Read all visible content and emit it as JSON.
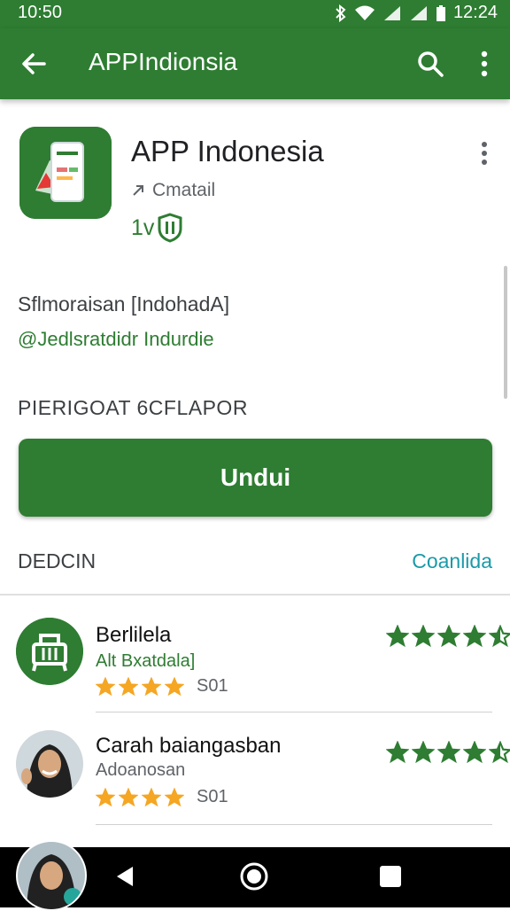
{
  "status_bar": {
    "time_left": "10:50",
    "time_right": "12:24"
  },
  "app_bar": {
    "title": "APPIndionsia"
  },
  "app": {
    "name": "APP Indonesia",
    "developer": "Cmatail",
    "rating": "1v",
    "icon_name": "phone-app-icon"
  },
  "details": {
    "line1": "Sflmoraisan [IndohadA]",
    "line2": "@Jedlsratdidr Indurdie"
  },
  "section_header": "PIERIGOAT 6CFLAPOR",
  "install_button": "Undui",
  "reviews_section": {
    "title": "DEDCIN",
    "link": "Coanlida"
  },
  "reviews": [
    {
      "name": "Berlilela",
      "subtitle": "Alt Bxatdala]",
      "count": "S01",
      "rating_small": 4,
      "rating_big": 4.5,
      "subtitle_color": "#2e7d32"
    },
    {
      "name": "Carah baiangasban",
      "subtitle": "Adoanosan",
      "count": "S01",
      "rating_small": 4,
      "rating_big": 4.5,
      "subtitle_color": "#5f6368"
    }
  ],
  "colors": {
    "primary": "#2e7d32",
    "accent_link": "#1a9aa8",
    "star_orange": "#f5a623"
  }
}
